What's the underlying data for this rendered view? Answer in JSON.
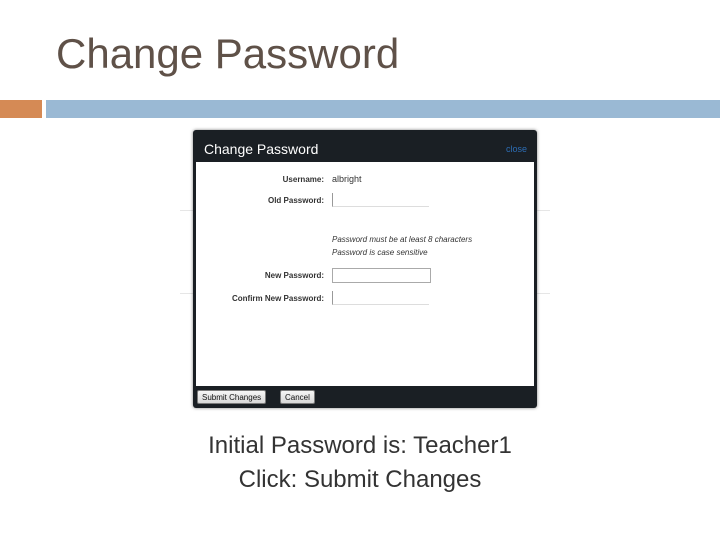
{
  "slide": {
    "title": "Change Password",
    "caption_lines": [
      "Initial Password is:  Teacher1",
      "Click:  Submit Changes"
    ],
    "colors": {
      "accent_orange": "#d58a55",
      "accent_blue": "#9ab9d4",
      "title_text": "#5f5148"
    }
  },
  "dialog": {
    "title": "Change Password",
    "close_label": "close",
    "fields": {
      "username_label": "Username:",
      "username_value": "albright",
      "old_password_label": "Old Password:",
      "new_password_label": "New Password:",
      "confirm_password_label": "Confirm New Password:"
    },
    "hints": [
      "Password must be at least 8 characters",
      "Password is case sensitive"
    ],
    "buttons": {
      "submit_label": "Submit Changes",
      "cancel_label": "Cancel"
    }
  }
}
